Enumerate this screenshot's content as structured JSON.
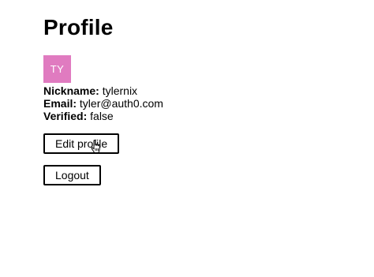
{
  "page": {
    "title": "Profile"
  },
  "avatar": {
    "initials": "TY",
    "background": "#e07bc0"
  },
  "profile": {
    "nickname_label": "Nickname:",
    "nickname_value": "tylernix",
    "email_label": "Email:",
    "email_value": "tyler@auth0.com",
    "verified_label": "Verified:",
    "verified_value": "false"
  },
  "actions": {
    "edit_label": "Edit profile",
    "logout_label": "Logout"
  },
  "cursor": {
    "icon": "hand-pointer-icon"
  }
}
